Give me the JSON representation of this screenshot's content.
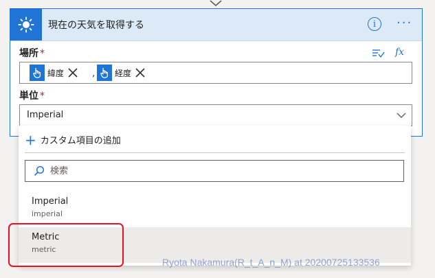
{
  "card": {
    "title": "現在の天気を取得する",
    "info_glyph": "i",
    "more_glyph": "···",
    "icon": "sun-icon"
  },
  "location": {
    "label": "場所",
    "required_mark": "*",
    "fx_label": "fx",
    "tokens": [
      {
        "label": "緯度",
        "icon": "touch-hand-icon"
      },
      {
        "label": "経度",
        "icon": "touch-hand-icon"
      }
    ],
    "separator": ","
  },
  "unit": {
    "label": "単位",
    "required_mark": "*",
    "value": "Imperial"
  },
  "dropdown": {
    "add_custom_label": "カスタム項目の追加",
    "search_placeholder": "検索",
    "options": [
      {
        "label": "Imperial",
        "value": "imperial",
        "hovered": false
      },
      {
        "label": "Metric",
        "value": "metric",
        "hovered": true
      }
    ]
  },
  "watermark": "Ryota Nakamura(R_t_A_n_M) at 20200725133536",
  "colors": {
    "accent": "#1f74d6",
    "header_bg": "#dce9f7",
    "highlight": "#e81123"
  }
}
